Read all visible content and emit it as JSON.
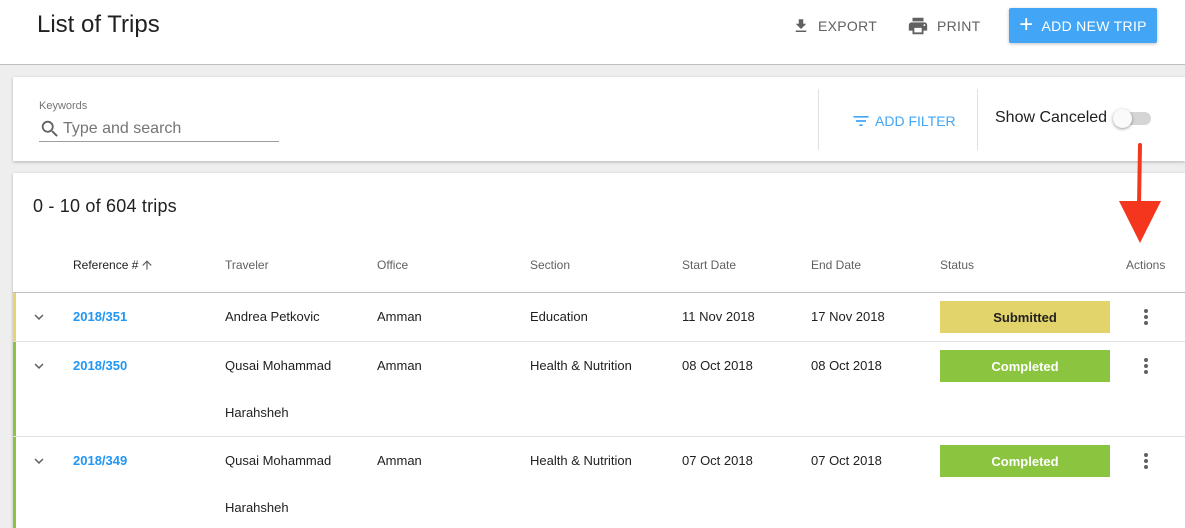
{
  "header": {
    "title": "List of Trips",
    "export_label": "EXPORT",
    "print_label": "PRINT",
    "add_label": "ADD NEW TRIP"
  },
  "filters": {
    "keywords_label": "Keywords",
    "search_placeholder": "Type and search",
    "add_filter_label": "ADD FILTER",
    "show_canceled_label": "Show Canceled",
    "show_canceled_on": false
  },
  "list": {
    "count_text": "0 - 10 of 604 trips",
    "columns": {
      "reference": "Reference #",
      "traveler": "Traveler",
      "office": "Office",
      "section": "Section",
      "start_date": "Start Date",
      "end_date": "End Date",
      "status": "Status",
      "actions": "Actions"
    },
    "rows": [
      {
        "reference": "2018/351",
        "traveler_line1": "Andrea Petkovic",
        "traveler_line2": "",
        "office": "Amman",
        "section": "Education",
        "start_date": "11 Nov 2018",
        "end_date": "17 Nov 2018",
        "status": "Submitted"
      },
      {
        "reference": "2018/350",
        "traveler_line1": "Qusai Mohammad",
        "traveler_line2": "Harahsheh",
        "office": "Amman",
        "section": "Health & Nutrition",
        "start_date": "08 Oct 2018",
        "end_date": "08 Oct 2018",
        "status": "Completed"
      },
      {
        "reference": "2018/349",
        "traveler_line1": "Qusai Mohammad",
        "traveler_line2": "Harahsheh",
        "office": "Amman",
        "section": "Health & Nutrition",
        "start_date": "07 Oct 2018",
        "end_date": "07 Oct 2018",
        "status": "Completed"
      }
    ]
  },
  "colors": {
    "accent": "#42a5f5",
    "link": "#2196f3",
    "submitted_bg": "#e2d46a",
    "submitted_text": "#212121",
    "submitted_bar": "#e6d56f",
    "completed_bg": "#8bc53f",
    "completed_text": "#ffffff",
    "completed_bar": "#8bc53f",
    "annotation_arrow": "#f4361f"
  },
  "icons": {
    "export": "download-icon",
    "print": "printer-icon",
    "add": "plus-icon",
    "search": "search-icon",
    "filter": "filter-icon",
    "sort": "arrow-up-icon",
    "expand": "chevron-down-icon",
    "actions": "more-vert-icon"
  }
}
